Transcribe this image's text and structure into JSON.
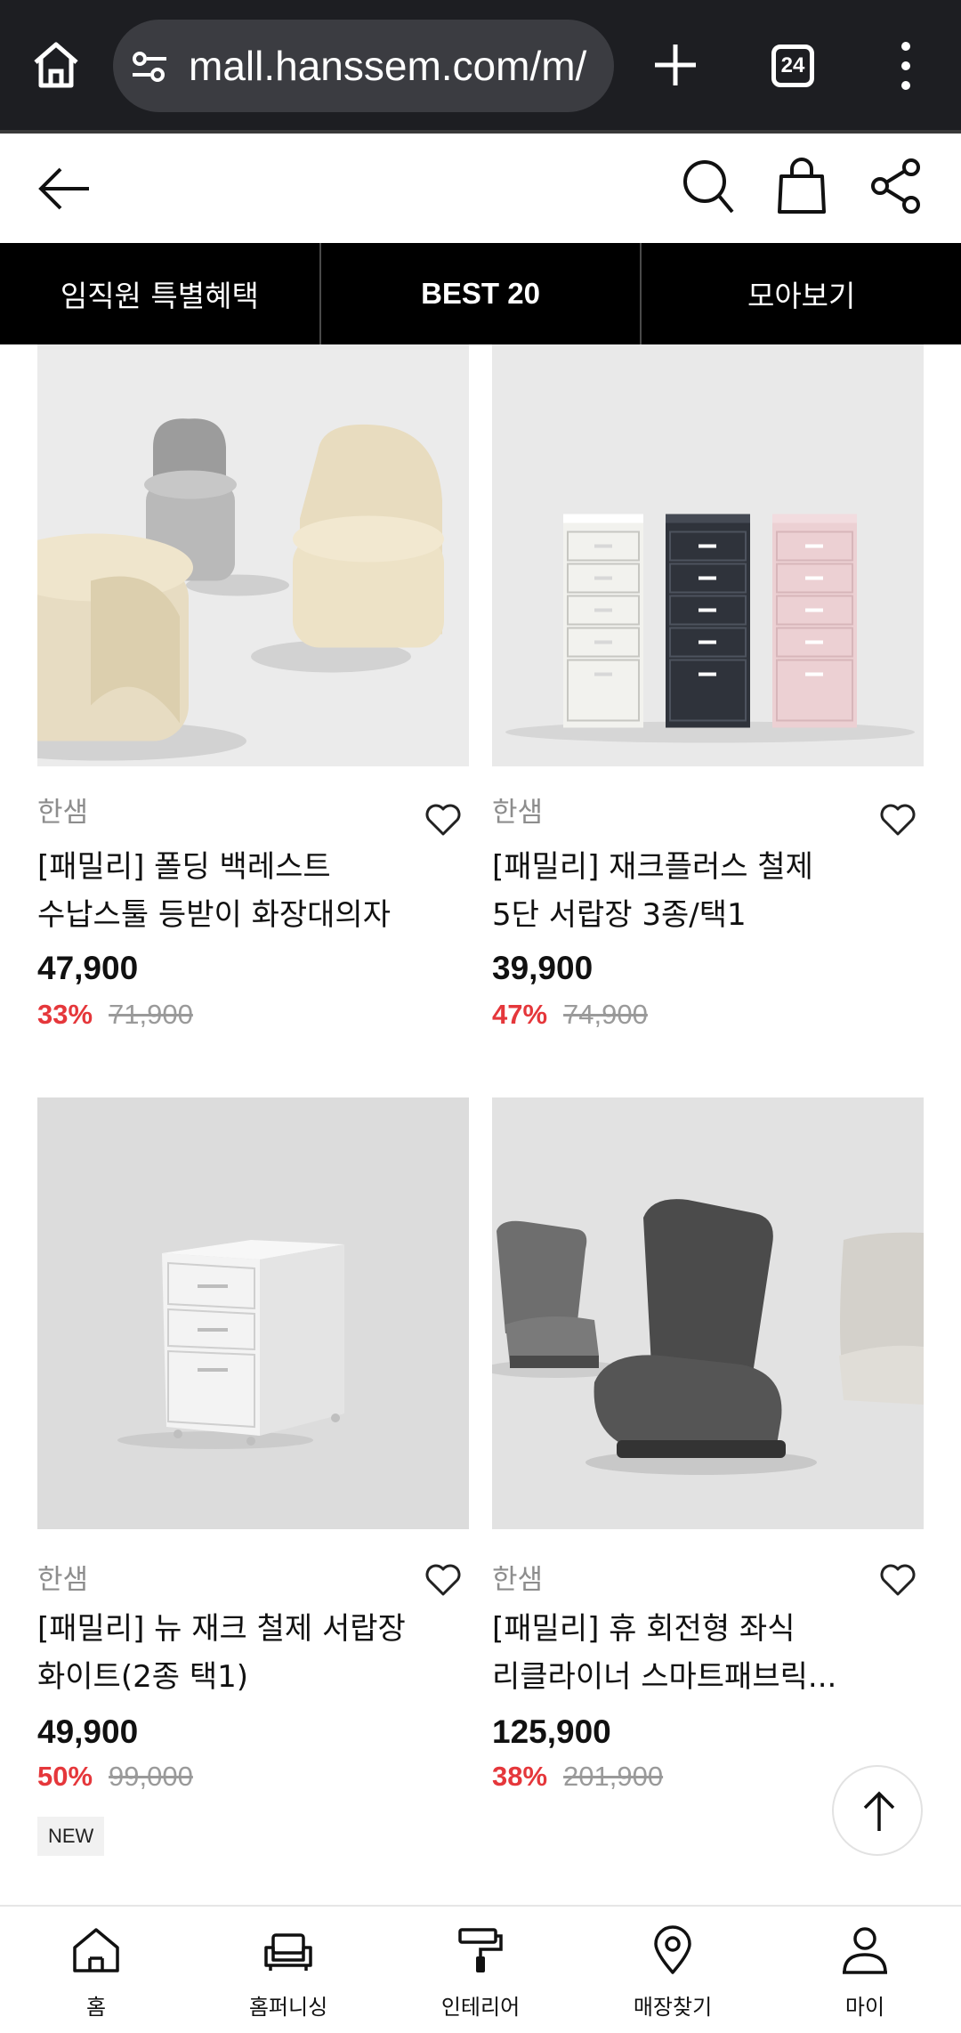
{
  "browser": {
    "url": "mall.hanssem.com/m/",
    "tab_count": "24"
  },
  "category_tabs": [
    {
      "label": "임직원 특별혜택"
    },
    {
      "label": "BEST 20"
    },
    {
      "label": "모아보기"
    }
  ],
  "products": [
    {
      "brand": "한샘",
      "name_line1": "[패밀리] 폴딩 백레스트",
      "name_line2": "수납스툴 등받이 화장대의자",
      "price": "47,900",
      "discount": "33%",
      "original_price": "71,900",
      "badge": ""
    },
    {
      "brand": "한샘",
      "name_line1": "[패밀리] 재크플러스 철제",
      "name_line2": "5단 서랍장 3종/택1",
      "price": "39,900",
      "discount": "47%",
      "original_price": "74,900",
      "badge": ""
    },
    {
      "brand": "한샘",
      "name_line1": "[패밀리] 뉴 재크 철제 서랍장",
      "name_line2": "화이트(2종 택1)",
      "price": "49,900",
      "discount": "50%",
      "original_price": "99,000",
      "badge": "NEW"
    },
    {
      "brand": "한샘",
      "name_line1": "[패밀리] 휴 회전형 좌식",
      "name_line2": "리클라이너 스마트패브릭...",
      "price": "125,900",
      "discount": "38%",
      "original_price": "201,900",
      "badge": ""
    }
  ],
  "bottom_nav": [
    {
      "label": "홈",
      "icon": "home-icon"
    },
    {
      "label": "홈퍼니싱",
      "icon": "sofa-icon"
    },
    {
      "label": "인테리어",
      "icon": "paint-roller-icon"
    },
    {
      "label": "매장찾기",
      "icon": "location-pin-icon"
    },
    {
      "label": "마이",
      "icon": "person-icon"
    }
  ],
  "colors": {
    "discount": "#e5373b",
    "tab_bar": "#000000",
    "browser_bar": "#1d1e22"
  }
}
